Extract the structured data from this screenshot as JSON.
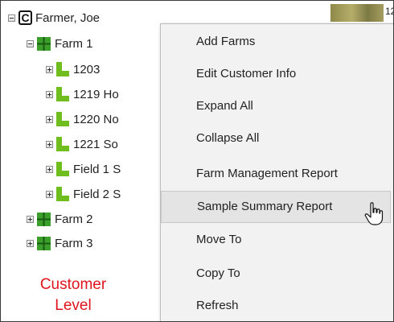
{
  "tree": {
    "customer": {
      "name": "Farmer, Joe",
      "icon": "customer-c-icon"
    },
    "farms": [
      {
        "label": "Farm 1",
        "expanded": true,
        "fields": [
          "1203",
          "1219 Ho",
          "1220 No",
          "1221 So",
          "Field 1 S",
          "Field 2 S"
        ]
      },
      {
        "label": "Farm 2",
        "expanded": false
      },
      {
        "label": "Farm 3",
        "expanded": false
      }
    ]
  },
  "annotation": {
    "line1": "Customer",
    "line2": "Level",
    "color": "#e0141c"
  },
  "thumbnail": {
    "partial_text": "12"
  },
  "context_menu": {
    "items": [
      "Add Farms",
      "Edit Customer Info",
      "Expand All",
      "Collapse All",
      "Farm Management Report",
      "Sample Summary Report",
      "Move To",
      "Copy To",
      "Refresh"
    ],
    "hovered_index": 5
  },
  "colors": {
    "farm_green": "#3aa02a",
    "field_green": "#6fbe1e",
    "menu_bg": "#f2f2f2"
  }
}
